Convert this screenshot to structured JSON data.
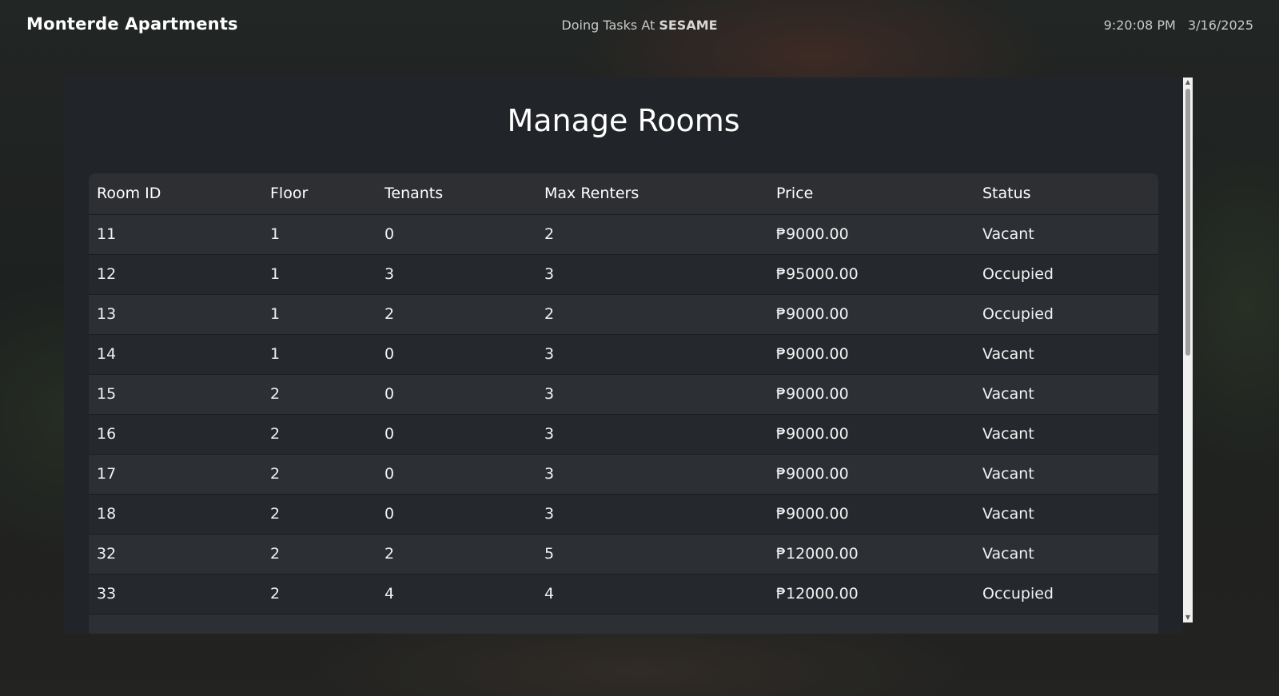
{
  "header": {
    "brand": "Monterde Apartments",
    "status_prefix": "Doing Tasks At",
    "status_location": "SESAME",
    "time": "9:20:08 PM",
    "date": "3/16/2025"
  },
  "panel": {
    "title": "Manage Rooms"
  },
  "table": {
    "headers": {
      "room_id": "Room ID",
      "floor": "Floor",
      "tenants": "Tenants",
      "max_renters": "Max Renters",
      "price": "Price",
      "status": "Status"
    },
    "rows": [
      {
        "room_id": "11",
        "floor": "1",
        "tenants": "0",
        "max_renters": "2",
        "price": "₱9000.00",
        "status": "Vacant"
      },
      {
        "room_id": "12",
        "floor": "1",
        "tenants": "3",
        "max_renters": "3",
        "price": "₱95000.00",
        "status": "Occupied"
      },
      {
        "room_id": "13",
        "floor": "1",
        "tenants": "2",
        "max_renters": "2",
        "price": "₱9000.00",
        "status": "Occupied"
      },
      {
        "room_id": "14",
        "floor": "1",
        "tenants": "0",
        "max_renters": "3",
        "price": "₱9000.00",
        "status": "Vacant"
      },
      {
        "room_id": "15",
        "floor": "2",
        "tenants": "0",
        "max_renters": "3",
        "price": "₱9000.00",
        "status": "Vacant"
      },
      {
        "room_id": "16",
        "floor": "2",
        "tenants": "0",
        "max_renters": "3",
        "price": "₱9000.00",
        "status": "Vacant"
      },
      {
        "room_id": "17",
        "floor": "2",
        "tenants": "0",
        "max_renters": "3",
        "price": "₱9000.00",
        "status": "Vacant"
      },
      {
        "room_id": "18",
        "floor": "2",
        "tenants": "0",
        "max_renters": "3",
        "price": "₱9000.00",
        "status": "Vacant"
      },
      {
        "room_id": "32",
        "floor": "2",
        "tenants": "2",
        "max_renters": "5",
        "price": "₱12000.00",
        "status": "Vacant"
      },
      {
        "room_id": "33",
        "floor": "2",
        "tenants": "4",
        "max_renters": "4",
        "price": "₱12000.00",
        "status": "Occupied"
      },
      {
        "room_id": "",
        "floor": "",
        "tenants": "",
        "max_renters": "",
        "price": "",
        "status": ""
      }
    ]
  },
  "scrollbar": {
    "up_icon": "scroll-up-arrow-icon",
    "down_icon": "scroll-down-arrow-icon"
  }
}
